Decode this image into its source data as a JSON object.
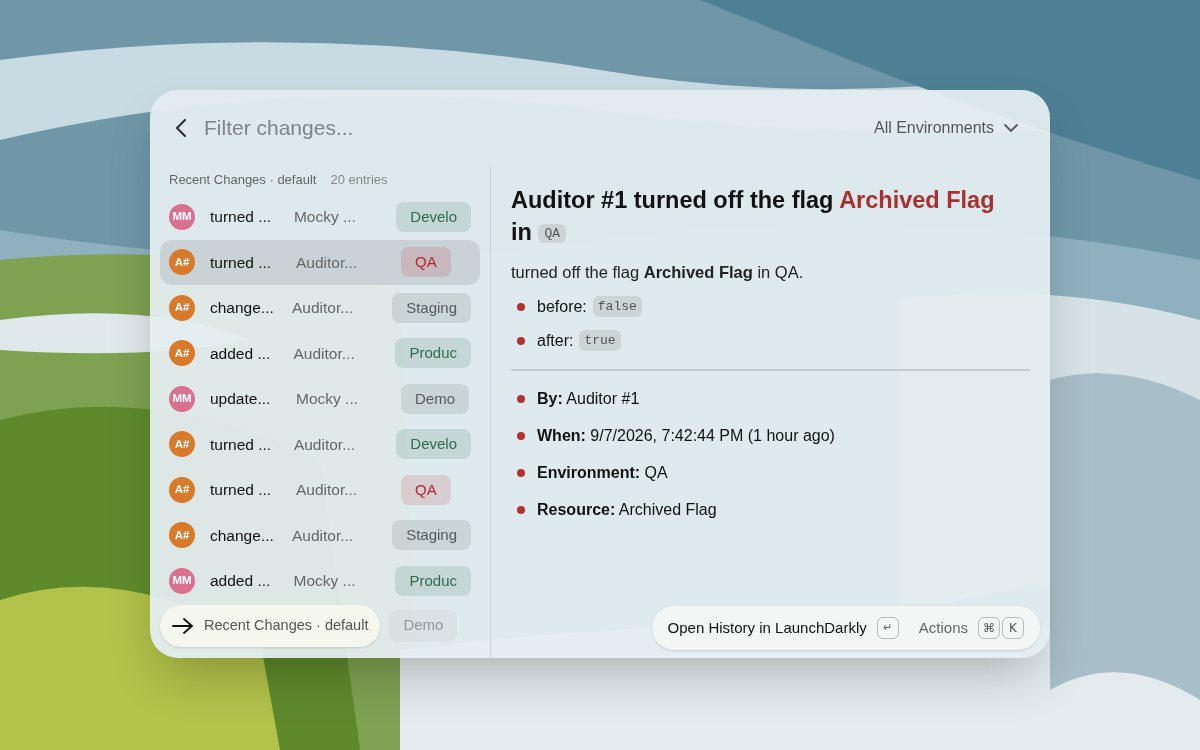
{
  "search": {
    "placeholder": "Filter changes..."
  },
  "environment_filter": {
    "label": "All Environments"
  },
  "list": {
    "title": "Recent Changes · default",
    "count": "20 entries",
    "rows": [
      {
        "avatar": {
          "initials": "MM",
          "color": "#d9708f"
        },
        "action": "turned ...",
        "actor": "Mocky ...",
        "environment": "Develo",
        "color": "#2f6b4f",
        "selected": false
      },
      {
        "avatar": {
          "initials": "A#",
          "color": "#d9792a"
        },
        "action": "turned ...",
        "actor": "Auditor...",
        "environment": "QA",
        "color": "#b3282d",
        "selected": true
      },
      {
        "avatar": {
          "initials": "A#",
          "color": "#d9792a"
        },
        "action": "change...",
        "actor": "Auditor...",
        "environment": "Staging",
        "color": "#555b60",
        "selected": false
      },
      {
        "avatar": {
          "initials": "A#",
          "color": "#d9792a"
        },
        "action": "added ...",
        "actor": "Auditor...",
        "environment": "Produc",
        "color": "#2f6b4f",
        "selected": false
      },
      {
        "avatar": {
          "initials": "MM",
          "color": "#d9708f"
        },
        "action": "update...",
        "actor": "Mocky ...",
        "environment": "Demo",
        "color": "#555b60",
        "selected": false
      },
      {
        "avatar": {
          "initials": "A#",
          "color": "#d9792a"
        },
        "action": "turned ...",
        "actor": "Auditor...",
        "environment": "Develo",
        "color": "#2f6b4f",
        "selected": false
      },
      {
        "avatar": {
          "initials": "A#",
          "color": "#d9792a"
        },
        "action": "turned ...",
        "actor": "Auditor...",
        "environment": "QA",
        "color": "#b3282d",
        "selected": false
      },
      {
        "avatar": {
          "initials": "A#",
          "color": "#d9792a"
        },
        "action": "change...",
        "actor": "Auditor...",
        "environment": "Staging",
        "color": "#555b60",
        "selected": false
      },
      {
        "avatar": {
          "initials": "MM",
          "color": "#d9708f"
        },
        "action": "added ...",
        "actor": "Mocky ...",
        "environment": "Produc",
        "color": "#2f6b4f",
        "selected": false
      }
    ],
    "faded_badge": {
      "environment": "Demo"
    }
  },
  "detail": {
    "title_start": "Auditor #1 turned off the flag",
    "title_flag": "Archived Flag",
    "title_end": "in",
    "title_environment": "QA",
    "summary": "turned off the flag **Archived Flag** in QA.",
    "values": [
      {
        "label": "before:",
        "value": "false"
      },
      {
        "label": "after:",
        "value": "true"
      }
    ],
    "facts": [
      {
        "label": "By:",
        "value": "Auditor #1"
      },
      {
        "label": "When:",
        "value": "9/7/2026, 7:42:44 PM (1 hour ago)"
      },
      {
        "label": "Environment:",
        "value": "QA"
      },
      {
        "label": "Resource:",
        "value": "Archived Flag"
      }
    ]
  },
  "footer": {
    "breadcrumb": "Recent Changes · default",
    "primary_action": "Open History in LaunchDarkly",
    "primary_key": "↵",
    "actions_label": "Actions",
    "actions_keys": [
      "⌘",
      "K"
    ]
  }
}
